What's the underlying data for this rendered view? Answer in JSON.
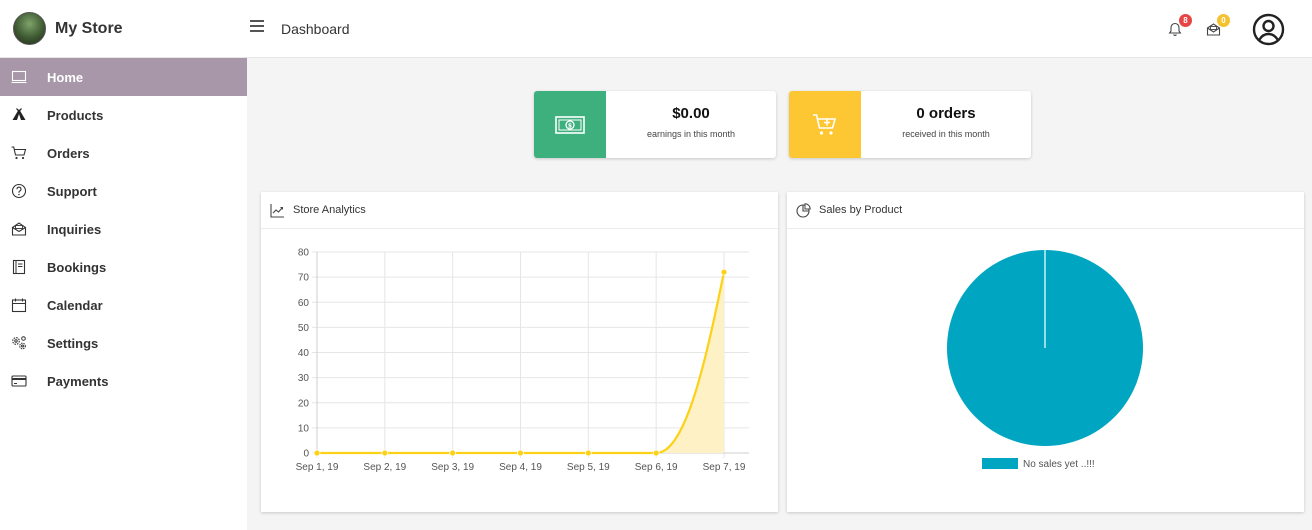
{
  "header": {
    "brand_name": "My Store",
    "page_title": "Dashboard",
    "notifications_count": "8",
    "messages_count": "0"
  },
  "sidebar": {
    "items": [
      {
        "label": "Home",
        "icon": "monitor-icon",
        "active": true
      },
      {
        "label": "Products",
        "icon": "tent-icon"
      },
      {
        "label": "Orders",
        "icon": "cart-icon"
      },
      {
        "label": "Support",
        "icon": "help-circle-icon"
      },
      {
        "label": "Inquiries",
        "icon": "mail-open-icon"
      },
      {
        "label": "Bookings",
        "icon": "book-icon"
      },
      {
        "label": "Calendar",
        "icon": "calendar-icon"
      },
      {
        "label": "Settings",
        "icon": "gears-icon"
      },
      {
        "label": "Payments",
        "icon": "credit-card-icon"
      }
    ]
  },
  "stats": {
    "earnings": {
      "value": "$0.00",
      "label": "earnings in this month",
      "color": "#3db07e",
      "icon": "cash-icon"
    },
    "orders": {
      "value": "0 orders",
      "label": "received in this month",
      "color": "#fcc733",
      "icon": "cart-plus-icon"
    }
  },
  "analytics": {
    "title": "Store Analytics",
    "icon": "trend-icon"
  },
  "sales_by_product": {
    "title": "Sales by Product",
    "icon": "pie-icon"
  },
  "colors": {
    "active_nav": "#a797a8",
    "line": "#fcd116",
    "fill": "#fdf1c5",
    "pie": "#00a6c1",
    "badge_red": "#e64545",
    "badge_yellow": "#f5c12e"
  },
  "chart_data": [
    {
      "type": "area",
      "title": "",
      "categories": [
        "Sep 1, 19",
        "Sep 2, 19",
        "Sep 3, 19",
        "Sep 4, 19",
        "Sep 5, 19",
        "Sep 6, 19",
        "Sep 7, 19"
      ],
      "values": [
        0,
        0,
        0,
        0,
        0,
        0,
        72
      ],
      "ylim": [
        0,
        80
      ],
      "yticks": [
        0,
        10,
        20,
        30,
        40,
        50,
        60,
        70,
        80
      ],
      "grid": true
    },
    {
      "type": "pie",
      "title": "",
      "labels": [
        "No sales yet ..!!!"
      ],
      "values": [
        1
      ],
      "legend": "bottom"
    }
  ]
}
